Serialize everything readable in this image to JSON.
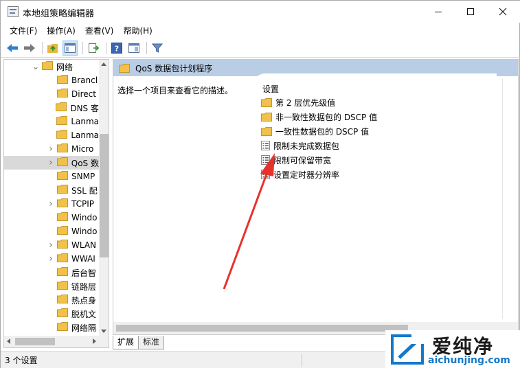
{
  "window": {
    "title": "本地组策略编辑器",
    "icons": [
      "policy-editor-icon",
      "minimize-icon",
      "maximize-icon",
      "close-icon"
    ]
  },
  "menu": [
    "文件(F)",
    "操作(A)",
    "查看(V)",
    "帮助(H)"
  ],
  "toolbar": {
    "icons": [
      "back-arrow-icon",
      "forward-arrow-icon",
      "up-folder-icon",
      "show-hide-tree-icon",
      "export-list-icon",
      "help-icon",
      "properties-icon",
      "filter-icon"
    ]
  },
  "tree": {
    "items": [
      {
        "label": "网络",
        "expander": "collapse",
        "selected": false,
        "level": 1
      },
      {
        "label": "Brancl",
        "expander": "",
        "selected": false,
        "level": 2
      },
      {
        "label": "Direct",
        "expander": "",
        "selected": false,
        "level": 2
      },
      {
        "label": "DNS 客",
        "expander": "",
        "selected": false,
        "level": 2
      },
      {
        "label": "Lanma",
        "expander": "",
        "selected": false,
        "level": 2
      },
      {
        "label": "Lanma",
        "expander": "",
        "selected": false,
        "level": 2
      },
      {
        "label": "Micro",
        "expander": "expand",
        "selected": false,
        "level": 2
      },
      {
        "label": "QoS 数",
        "expander": "expand",
        "selected": true,
        "level": 2
      },
      {
        "label": "SNMP",
        "expander": "",
        "selected": false,
        "level": 2
      },
      {
        "label": "SSL 配",
        "expander": "",
        "selected": false,
        "level": 2
      },
      {
        "label": "TCPIP",
        "expander": "expand",
        "selected": false,
        "level": 2
      },
      {
        "label": "Windo",
        "expander": "",
        "selected": false,
        "level": 2
      },
      {
        "label": "Windo",
        "expander": "",
        "selected": false,
        "level": 2
      },
      {
        "label": "WLAN",
        "expander": "expand",
        "selected": false,
        "level": 2
      },
      {
        "label": "WWAI",
        "expander": "expand",
        "selected": false,
        "level": 2
      },
      {
        "label": "后台智",
        "expander": "",
        "selected": false,
        "level": 2
      },
      {
        "label": "链路层",
        "expander": "",
        "selected": false,
        "level": 2
      },
      {
        "label": "热点身",
        "expander": "",
        "selected": false,
        "level": 2
      },
      {
        "label": "脱机文",
        "expander": "",
        "selected": false,
        "level": 2
      },
      {
        "label": "网络隔",
        "expander": "",
        "selected": false,
        "level": 2
      }
    ]
  },
  "details": {
    "header": "QoS 数据包计划程序",
    "description": "选择一个项目来查看它的描述。",
    "column_header": "设置",
    "items": [
      {
        "label": "第 2 层优先级值",
        "type": "folder"
      },
      {
        "label": "非一致性数据包的 DSCP 值",
        "type": "folder"
      },
      {
        "label": "一致性数据包的 DSCP 值",
        "type": "folder"
      },
      {
        "label": "限制未完成数据包",
        "type": "setting"
      },
      {
        "label": "限制可保留带宽",
        "type": "setting"
      },
      {
        "label": "设置定时器分辨率",
        "type": "setting"
      }
    ]
  },
  "tabs": [
    "扩展",
    "标准"
  ],
  "status": "3 个设置",
  "watermark": {
    "brand": "爱纯净",
    "url": "aichunjing.com"
  },
  "colors": {
    "header_bg": "#b9cde5",
    "folder": "#f0c24b",
    "selected": "#d9d9d9",
    "arrow": "#e8312a",
    "url": "#1479c9"
  }
}
